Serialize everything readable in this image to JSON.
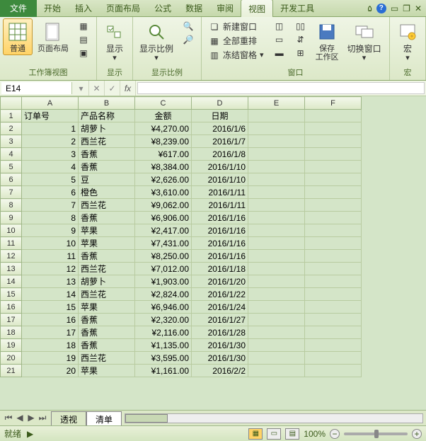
{
  "tabs": {
    "file": "文件",
    "home": "开始",
    "insert": "插入",
    "layout": "页面布局",
    "formula": "公式",
    "data": "数据",
    "review": "审阅",
    "view": "视图",
    "dev": "开发工具"
  },
  "ribbon": {
    "workbook_views": {
      "label": "工作簿视图",
      "normal": "普通",
      "page_layout": "页面布局"
    },
    "show": {
      "label": "显示",
      "btn": "显示"
    },
    "zoom": {
      "label": "显示比例",
      "btn": "显示比例"
    },
    "window": {
      "label": "窗口",
      "new": "新建窗口",
      "arrange": "全部重排",
      "freeze": "冻结窗格",
      "save_ws": "保存\n工作区",
      "switch": "切换窗口"
    },
    "macros": {
      "label": "宏",
      "btn": "宏"
    }
  },
  "namebox": "E14",
  "columns": [
    "A",
    "B",
    "C",
    "D",
    "E",
    "F"
  ],
  "headers": {
    "order": "订单号",
    "product": "产品名称",
    "amount": "金额",
    "date": "日期"
  },
  "rows": [
    {
      "n": 1,
      "p": "胡萝卜",
      "a": "¥4,270.00",
      "d": "2016/1/6"
    },
    {
      "n": 2,
      "p": "西兰花",
      "a": "¥8,239.00",
      "d": "2016/1/7"
    },
    {
      "n": 3,
      "p": "香蕉",
      "a": "¥617.00",
      "d": "2016/1/8"
    },
    {
      "n": 4,
      "p": "香蕉",
      "a": "¥8,384.00",
      "d": "2016/1/10"
    },
    {
      "n": 5,
      "p": "豆",
      "a": "¥2,626.00",
      "d": "2016/1/10"
    },
    {
      "n": 6,
      "p": "橙色",
      "a": "¥3,610.00",
      "d": "2016/1/11"
    },
    {
      "n": 7,
      "p": "西兰花",
      "a": "¥9,062.00",
      "d": "2016/1/11"
    },
    {
      "n": 8,
      "p": "香蕉",
      "a": "¥6,906.00",
      "d": "2016/1/16"
    },
    {
      "n": 9,
      "p": "苹果",
      "a": "¥2,417.00",
      "d": "2016/1/16"
    },
    {
      "n": 10,
      "p": "苹果",
      "a": "¥7,431.00",
      "d": "2016/1/16"
    },
    {
      "n": 11,
      "p": "香蕉",
      "a": "¥8,250.00",
      "d": "2016/1/16"
    },
    {
      "n": 12,
      "p": "西兰花",
      "a": "¥7,012.00",
      "d": "2016/1/18"
    },
    {
      "n": 13,
      "p": "胡萝卜",
      "a": "¥1,903.00",
      "d": "2016/1/20"
    },
    {
      "n": 14,
      "p": "西兰花",
      "a": "¥2,824.00",
      "d": "2016/1/22"
    },
    {
      "n": 15,
      "p": "苹果",
      "a": "¥6,946.00",
      "d": "2016/1/24"
    },
    {
      "n": 16,
      "p": "香蕉",
      "a": "¥2,320.00",
      "d": "2016/1/27"
    },
    {
      "n": 17,
      "p": "香蕉",
      "a": "¥2,116.00",
      "d": "2016/1/28"
    },
    {
      "n": 18,
      "p": "香蕉",
      "a": "¥1,135.00",
      "d": "2016/1/30"
    },
    {
      "n": 19,
      "p": "西兰花",
      "a": "¥3,595.00",
      "d": "2016/1/30"
    },
    {
      "n": 20,
      "p": "苹果",
      "a": "¥1,161.00",
      "d": "2016/2/2"
    }
  ],
  "sheets": {
    "pivot": "透视",
    "list": "清单"
  },
  "status": {
    "ready": "就绪",
    "zoom": "100%"
  }
}
